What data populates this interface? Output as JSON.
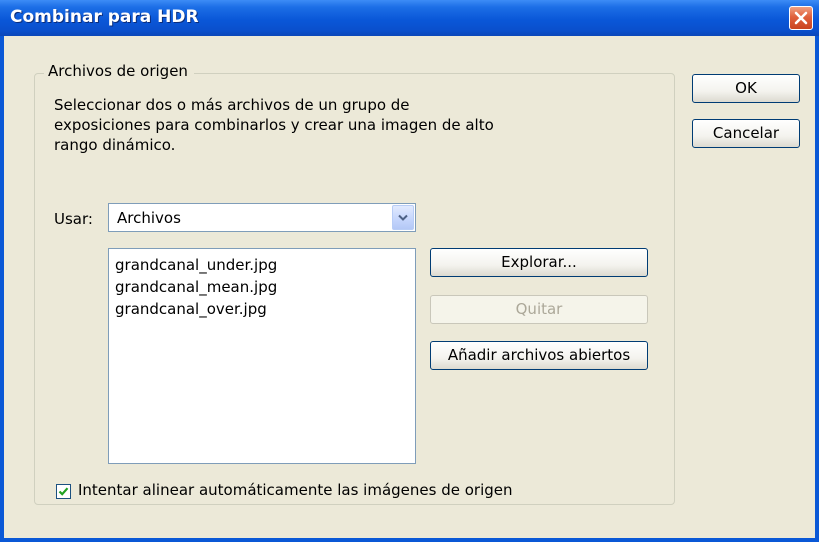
{
  "window": {
    "title": "Combinar para HDR"
  },
  "source_group": {
    "legend": "Archivos de origen",
    "description_lines": [
      "Seleccionar dos o más archivos de un grupo de",
      "exposiciones para combinarlos y crear una imagen de alto",
      "rango dinámico."
    ]
  },
  "usar": {
    "label": "Usar:",
    "selected": "Archivos"
  },
  "files": [
    "grandcanal_under.jpg",
    "grandcanal_mean.jpg",
    "grandcanal_over.jpg"
  ],
  "buttons": {
    "ok": "OK",
    "cancel": "Cancelar",
    "browse": "Explorar...",
    "remove": "Quitar",
    "add_open": "Añadir archivos abiertos"
  },
  "align_option": {
    "label": "Intentar alinear automáticamente las imágenes de origen",
    "checked": true
  },
  "colors": {
    "titlebar": "#0a58d6",
    "dialog_bg": "#ece9d8",
    "close_button": "#e0603c",
    "checkmark": "#21a121"
  },
  "icons": {
    "close": "close-x-icon",
    "dropdown": "chevron-down-icon",
    "check": "checkmark-icon"
  }
}
